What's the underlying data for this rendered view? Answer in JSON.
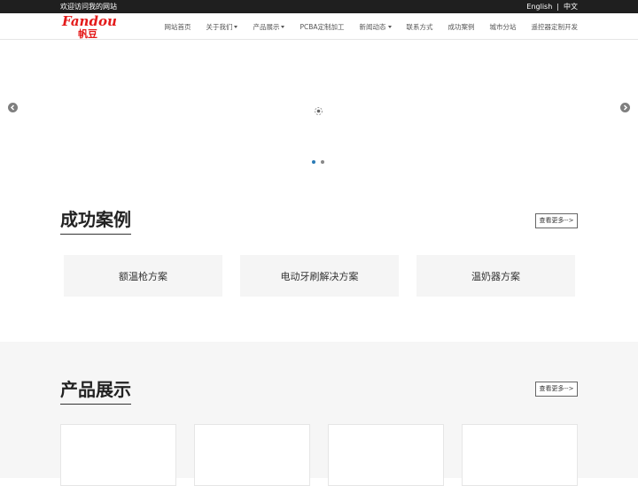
{
  "topbar": {
    "welcome": "欢迎访问我的网站",
    "lang_en": "English",
    "separator": "|",
    "lang_zh": "中文"
  },
  "logo": {
    "word": "Fandou",
    "chinese": "帆豆",
    "color": "#e41b1b"
  },
  "nav": {
    "items": [
      {
        "label": "网站首页",
        "dropdown": false
      },
      {
        "label": "关于我们",
        "dropdown": true
      },
      {
        "label": "产品展示",
        "dropdown": true
      },
      {
        "label": "PCBA定制加工",
        "dropdown": false
      },
      {
        "label": "新闻动态",
        "dropdown": true
      },
      {
        "label": "联系方式",
        "dropdown": false
      },
      {
        "label": "成功案例",
        "dropdown": false
      },
      {
        "label": "城市分站",
        "dropdown": false
      },
      {
        "label": "遥控器定制开发",
        "dropdown": false
      }
    ]
  },
  "banner": {
    "prev_icon": "chevron-left-icon",
    "next_icon": "chevron-right-icon",
    "loader_icon": "loading-spinner-icon",
    "slides": 2,
    "active_slide": 1,
    "active_color": "#2a7ab5"
  },
  "cases": {
    "title": "成功案例",
    "more_label": "查看更多-->",
    "items": [
      "额温枪方案",
      "电动牙刷解决方案",
      "温奶器方案"
    ]
  },
  "products": {
    "title": "产品展示",
    "more_label": "查看更多-->",
    "card_count": 4
  }
}
